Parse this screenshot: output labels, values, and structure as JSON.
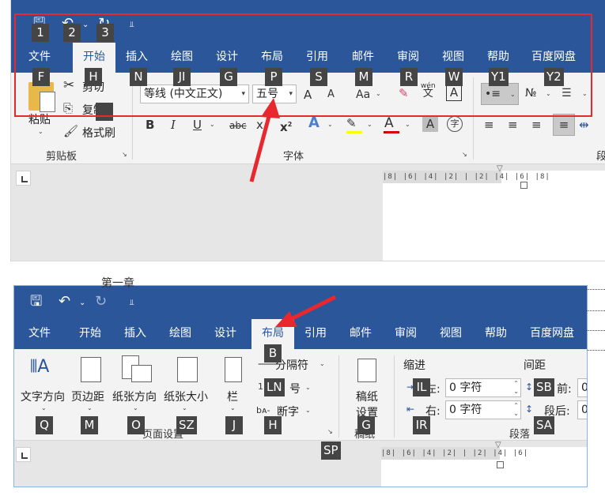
{
  "panel1": {
    "qat_keys": [
      "1",
      "2",
      "3"
    ],
    "tabs": [
      {
        "label": "文件",
        "key": "F"
      },
      {
        "label": "开始",
        "key": "H",
        "active": true
      },
      {
        "label": "插入",
        "key": "N"
      },
      {
        "label": "绘图",
        "key": "JI"
      },
      {
        "label": "设计",
        "key": "G"
      },
      {
        "label": "布局",
        "key": "P"
      },
      {
        "label": "引用",
        "key": "S"
      },
      {
        "label": "邮件",
        "key": "M"
      },
      {
        "label": "审阅",
        "key": "R"
      },
      {
        "label": "视图",
        "key": "W"
      },
      {
        "label": "帮助",
        "key": "Y1"
      },
      {
        "label": "百度网盘",
        "key": "Y2"
      }
    ],
    "clipboard": {
      "paste_label": "粘贴",
      "cut_label": "剪切",
      "copy_label": "复制",
      "format_painter_label": "格式刷",
      "group_label": "剪贴板"
    },
    "font": {
      "font_name": "等线 (中文正文)",
      "font_size": "五号",
      "grow_glyph": "A",
      "shrink_glyph": "A",
      "case_glyph": "Aa",
      "pinyin_glyph_top": "wén",
      "pinyin_glyph_bottom": "文",
      "border_glyph": "A",
      "bold": "B",
      "italic": "I",
      "underline": "U",
      "strike": "abc",
      "sub": "x",
      "sup": "x",
      "sub_suffix": "2",
      "sup_suffix": "2",
      "text_effect": "A",
      "font_color": "A",
      "shade": "A",
      "enclose": "字",
      "group_label": "字体"
    },
    "paragraph_label_partial": "段",
    "ruler_text": "|8|  |6|  |4|  |2|  |   |2|  |4|  |6|  |8|"
  },
  "panel2": {
    "chapter_text": "第一章",
    "tabs": [
      {
        "label": "文件"
      },
      {
        "label": "开始"
      },
      {
        "label": "插入"
      },
      {
        "label": "绘图"
      },
      {
        "label": "设计"
      },
      {
        "label": "布局",
        "active": true,
        "key": "B"
      },
      {
        "label": "引用"
      },
      {
        "label": "邮件"
      },
      {
        "label": "审阅"
      },
      {
        "label": "视图"
      },
      {
        "label": "帮助"
      },
      {
        "label": "百度网盘"
      }
    ],
    "page_setup": {
      "text_direction": "文字方向",
      "margins": "页边距",
      "orientation": "纸张方向",
      "size": "纸张大小",
      "columns": "栏",
      "breaks": "分隔符",
      "line_numbers": "号",
      "hyphenation": "断字",
      "group_label": "页面设置",
      "keys": {
        "text_direction": "Q",
        "margins": "M",
        "orientation": "O",
        "size": "SZ",
        "columns": "J",
        "breaks": "B",
        "line_numbers": "LN",
        "hyphenation": "H",
        "launcher": "SP"
      }
    },
    "manuscript": {
      "label_line1": "稿纸",
      "label_line2": "设置",
      "group_label": "稿纸",
      "key": "G"
    },
    "indent": {
      "title": "缩进",
      "left_label": "左:",
      "left_value": "0 字符",
      "right_label": "右:",
      "right_value": "0 字符",
      "keys": {
        "left": "IL",
        "right": "IR"
      }
    },
    "spacing": {
      "title": "间距",
      "before_label": "前:",
      "after_label": "段后:",
      "before_value": "0",
      "after_value": "0",
      "keys": {
        "before": "SB",
        "after": "SA"
      }
    },
    "paragraph_group_label": "段落",
    "ruler_text": "|8|  |6|  |4|  |2|  |   |2|  |4|  |6|"
  },
  "colors": {
    "title_blue": "#2b579a",
    "ribbon_gray": "#f3f3f3",
    "keytip_bg": "#454545",
    "highlight_red": "#e8272e",
    "highlighter_yellow": "#ffff00",
    "font_color_red": "#d00000"
  }
}
